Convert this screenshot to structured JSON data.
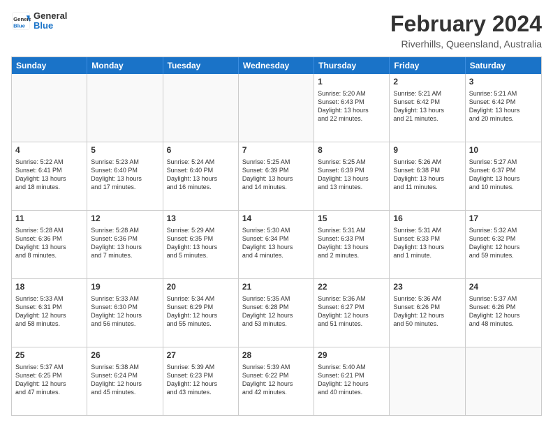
{
  "header": {
    "logo_general": "General",
    "logo_blue": "Blue",
    "month_title": "February 2024",
    "location": "Riverhills, Queensland, Australia"
  },
  "days_of_week": [
    "Sunday",
    "Monday",
    "Tuesday",
    "Wednesday",
    "Thursday",
    "Friday",
    "Saturday"
  ],
  "rows": [
    [
      {
        "day": "",
        "info": ""
      },
      {
        "day": "",
        "info": ""
      },
      {
        "day": "",
        "info": ""
      },
      {
        "day": "",
        "info": ""
      },
      {
        "day": "1",
        "info": "Sunrise: 5:20 AM\nSunset: 6:43 PM\nDaylight: 13 hours\nand 22 minutes."
      },
      {
        "day": "2",
        "info": "Sunrise: 5:21 AM\nSunset: 6:42 PM\nDaylight: 13 hours\nand 21 minutes."
      },
      {
        "day": "3",
        "info": "Sunrise: 5:21 AM\nSunset: 6:42 PM\nDaylight: 13 hours\nand 20 minutes."
      }
    ],
    [
      {
        "day": "4",
        "info": "Sunrise: 5:22 AM\nSunset: 6:41 PM\nDaylight: 13 hours\nand 18 minutes."
      },
      {
        "day": "5",
        "info": "Sunrise: 5:23 AM\nSunset: 6:40 PM\nDaylight: 13 hours\nand 17 minutes."
      },
      {
        "day": "6",
        "info": "Sunrise: 5:24 AM\nSunset: 6:40 PM\nDaylight: 13 hours\nand 16 minutes."
      },
      {
        "day": "7",
        "info": "Sunrise: 5:25 AM\nSunset: 6:39 PM\nDaylight: 13 hours\nand 14 minutes."
      },
      {
        "day": "8",
        "info": "Sunrise: 5:25 AM\nSunset: 6:39 PM\nDaylight: 13 hours\nand 13 minutes."
      },
      {
        "day": "9",
        "info": "Sunrise: 5:26 AM\nSunset: 6:38 PM\nDaylight: 13 hours\nand 11 minutes."
      },
      {
        "day": "10",
        "info": "Sunrise: 5:27 AM\nSunset: 6:37 PM\nDaylight: 13 hours\nand 10 minutes."
      }
    ],
    [
      {
        "day": "11",
        "info": "Sunrise: 5:28 AM\nSunset: 6:36 PM\nDaylight: 13 hours\nand 8 minutes."
      },
      {
        "day": "12",
        "info": "Sunrise: 5:28 AM\nSunset: 6:36 PM\nDaylight: 13 hours\nand 7 minutes."
      },
      {
        "day": "13",
        "info": "Sunrise: 5:29 AM\nSunset: 6:35 PM\nDaylight: 13 hours\nand 5 minutes."
      },
      {
        "day": "14",
        "info": "Sunrise: 5:30 AM\nSunset: 6:34 PM\nDaylight: 13 hours\nand 4 minutes."
      },
      {
        "day": "15",
        "info": "Sunrise: 5:31 AM\nSunset: 6:33 PM\nDaylight: 13 hours\nand 2 minutes."
      },
      {
        "day": "16",
        "info": "Sunrise: 5:31 AM\nSunset: 6:33 PM\nDaylight: 13 hours\nand 1 minute."
      },
      {
        "day": "17",
        "info": "Sunrise: 5:32 AM\nSunset: 6:32 PM\nDaylight: 12 hours\nand 59 minutes."
      }
    ],
    [
      {
        "day": "18",
        "info": "Sunrise: 5:33 AM\nSunset: 6:31 PM\nDaylight: 12 hours\nand 58 minutes."
      },
      {
        "day": "19",
        "info": "Sunrise: 5:33 AM\nSunset: 6:30 PM\nDaylight: 12 hours\nand 56 minutes."
      },
      {
        "day": "20",
        "info": "Sunrise: 5:34 AM\nSunset: 6:29 PM\nDaylight: 12 hours\nand 55 minutes."
      },
      {
        "day": "21",
        "info": "Sunrise: 5:35 AM\nSunset: 6:28 PM\nDaylight: 12 hours\nand 53 minutes."
      },
      {
        "day": "22",
        "info": "Sunrise: 5:36 AM\nSunset: 6:27 PM\nDaylight: 12 hours\nand 51 minutes."
      },
      {
        "day": "23",
        "info": "Sunrise: 5:36 AM\nSunset: 6:26 PM\nDaylight: 12 hours\nand 50 minutes."
      },
      {
        "day": "24",
        "info": "Sunrise: 5:37 AM\nSunset: 6:26 PM\nDaylight: 12 hours\nand 48 minutes."
      }
    ],
    [
      {
        "day": "25",
        "info": "Sunrise: 5:37 AM\nSunset: 6:25 PM\nDaylight: 12 hours\nand 47 minutes."
      },
      {
        "day": "26",
        "info": "Sunrise: 5:38 AM\nSunset: 6:24 PM\nDaylight: 12 hours\nand 45 minutes."
      },
      {
        "day": "27",
        "info": "Sunrise: 5:39 AM\nSunset: 6:23 PM\nDaylight: 12 hours\nand 43 minutes."
      },
      {
        "day": "28",
        "info": "Sunrise: 5:39 AM\nSunset: 6:22 PM\nDaylight: 12 hours\nand 42 minutes."
      },
      {
        "day": "29",
        "info": "Sunrise: 5:40 AM\nSunset: 6:21 PM\nDaylight: 12 hours\nand 40 minutes."
      },
      {
        "day": "",
        "info": ""
      },
      {
        "day": "",
        "info": ""
      }
    ]
  ]
}
